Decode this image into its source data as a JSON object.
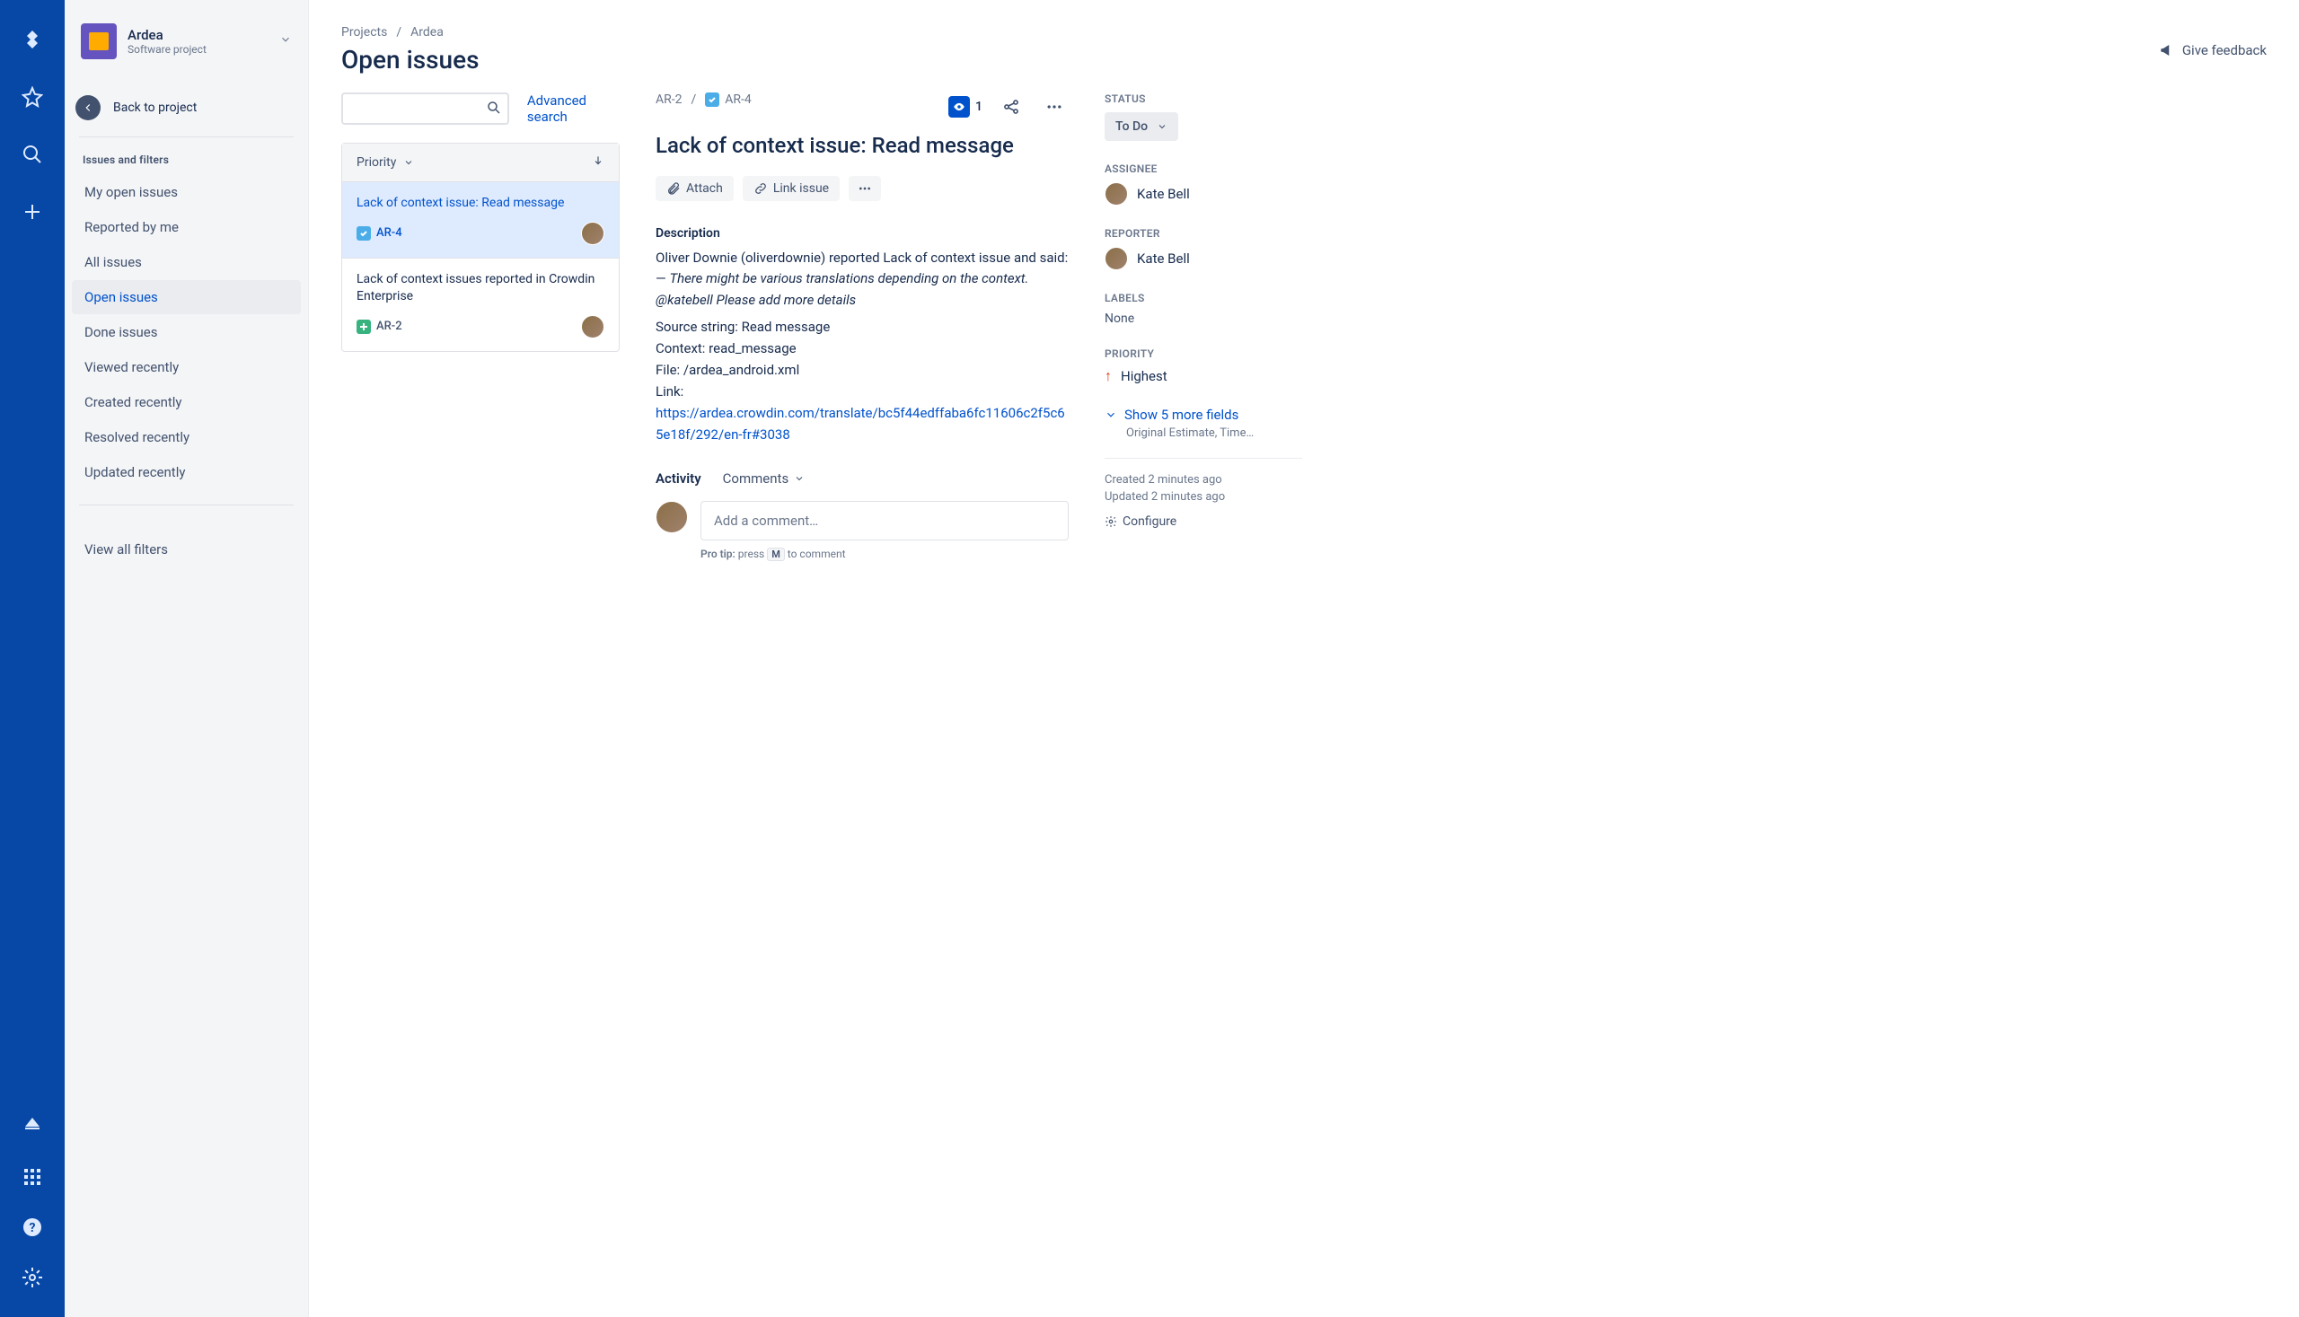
{
  "rail": {
    "icons": [
      "jira-logo",
      "star",
      "search",
      "add",
      "notification",
      "apps",
      "help",
      "settings"
    ]
  },
  "sidebar": {
    "project_name": "Ardea",
    "project_type": "Software project",
    "back": "Back to project",
    "section": "Issues and filters",
    "filters": [
      {
        "label": "My open issues"
      },
      {
        "label": "Reported by me"
      },
      {
        "label": "All issues"
      },
      {
        "label": "Open issues",
        "active": true
      },
      {
        "label": "Done issues"
      },
      {
        "label": "Viewed recently"
      },
      {
        "label": "Created recently"
      },
      {
        "label": "Resolved recently"
      },
      {
        "label": "Updated recently"
      }
    ],
    "view_all": "View all filters"
  },
  "breadcrumb": {
    "root": "Projects",
    "project": "Ardea"
  },
  "page_title": "Open issues",
  "feedback": "Give feedback",
  "advanced_search": "Advanced search",
  "list_sort": "Priority",
  "issues": [
    {
      "title": "Lack of context issue: Read message",
      "key": "AR-4",
      "type": "task",
      "selected": true
    },
    {
      "title": "Lack of context issues reported in Crowdin Enterprise",
      "key": "AR-2",
      "type": "story"
    }
  ],
  "issue_crumb": {
    "parent": "AR-2",
    "key": "AR-4"
  },
  "watch_count": "1",
  "issue_title": "Lack of context issue: Read message",
  "actions": {
    "attach": "Attach",
    "link": "Link issue"
  },
  "description": {
    "label": "Description",
    "intro": "Oliver Downie (oliverdownie) reported Lack of context issue and said: — ",
    "quote": "There might be various translations depending on the context. @katebell Please add more details",
    "source_label": "Source string: ",
    "source_value": "Read message",
    "context_label": "Context: ",
    "context_value": "read_message",
    "file_label": "File: ",
    "file_value": "/ardea_android.xml",
    "link_label": "Link:",
    "link_url": "https://ardea.crowdin.com/translate/bc5f44edffaba6fc11606c2f5c65e18f/292/en-fr#3038"
  },
  "activity": {
    "label": "Activity",
    "tab": "Comments",
    "placeholder": "Add a comment…",
    "tip_bold": "Pro tip:",
    "tip_before": " press ",
    "tip_key": "M",
    "tip_after": " to comment"
  },
  "side": {
    "status_label": "STATUS",
    "status_value": "To Do",
    "assignee_label": "ASSIGNEE",
    "assignee_name": "Kate Bell",
    "reporter_label": "REPORTER",
    "reporter_name": "Kate Bell",
    "labels_label": "LABELS",
    "labels_value": "None",
    "priority_label": "PRIORITY",
    "priority_value": "Highest",
    "more_fields": "Show 5 more fields",
    "more_fields_sub": "Original Estimate, Time…",
    "created": "Created 2 minutes ago",
    "updated": "Updated 2 minutes ago",
    "configure": "Configure"
  }
}
